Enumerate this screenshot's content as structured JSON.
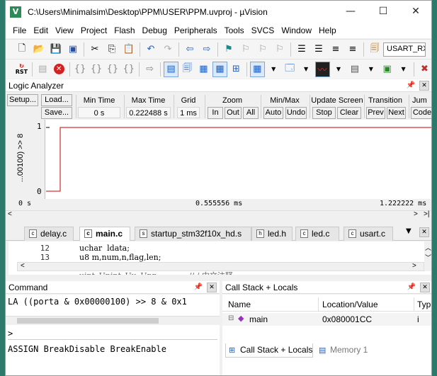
{
  "window": {
    "title": "C:\\Users\\Minimalsim\\Desktop\\PPM\\USER\\PPM.uvproj - µVision",
    "logo_text": "V",
    "minimize": "—",
    "maximize": "☐",
    "close": "✕"
  },
  "menu": [
    "File",
    "Edit",
    "View",
    "Project",
    "Flash",
    "Debug",
    "Peripherals",
    "Tools",
    "SVCS",
    "Window",
    "Help"
  ],
  "toolbar": {
    "target_combo": "USART_RX_",
    "reset_label": "RST"
  },
  "logic_analyzer": {
    "title": "Logic Analyzer",
    "setup_button": "Setup...",
    "load_button": "Load...",
    "save_button": "Save...",
    "min_time_label": "Min Time",
    "min_time_value": "0 s",
    "max_time_label": "Max Time",
    "max_time_value": "0.222488 s",
    "grid_label": "Grid",
    "grid_value": "1 ms",
    "zoom_label": "Zoom",
    "zoom_in": "In",
    "zoom_out": "Out",
    "zoom_all": "All",
    "minmax_label": "Min/Max",
    "minmax_auto": "Auto",
    "minmax_undo": "Undo",
    "update_label": "Update Screen",
    "update_stop": "Stop",
    "update_clear": "Clear",
    "transition_label": "Transition",
    "transition_prev": "Prev",
    "transition_next": "Next",
    "jump_label": "Jum",
    "jump_code": "Code",
    "signal_name": "...00100) >> 8",
    "y_high": "1",
    "y_low": "0",
    "axis_left": "0 s",
    "axis_mid": "0.555556 ms",
    "axis_right": "1.222222 ms"
  },
  "file_tabs": [
    "delay.c",
    "main.c",
    "startup_stm32f10x_hd.s",
    "led.h",
    "led.c",
    "usart.c"
  ],
  "editor": {
    "lines": [
      {
        "num": "12",
        "code": "uchar  ldata;"
      },
      {
        "num": "13",
        "code": "u8 m,num,n,flag,len;"
      }
    ],
    "partial_line": "uint_Unint_Uu_Unn_____     // / 中文注释"
  },
  "command": {
    "title": "Command",
    "output_line": "LA ((porta & 0x00000100) >> 8 & 0x1",
    "prompt": ">",
    "hint": "ASSIGN BreakDisable BreakEnable"
  },
  "callstack": {
    "title": "Call Stack + Locals",
    "col_name": "Name",
    "col_location": "Location/Value",
    "col_type": "Typ",
    "row_name": "main",
    "row_location": "0x080001CC",
    "row_type": "i",
    "tab_callstack": "Call Stack + Locals",
    "tab_memory": "Memory 1"
  },
  "colors": {
    "signal": "#cc0000",
    "background_desktop": "#2b7a6b"
  }
}
